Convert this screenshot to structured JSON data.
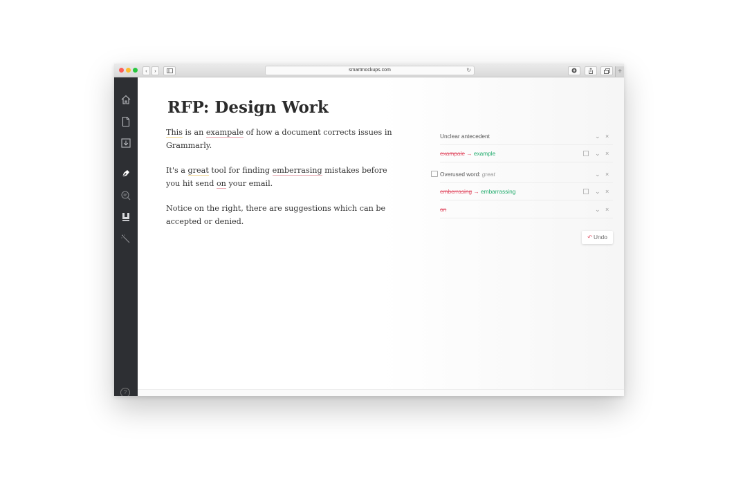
{
  "browser": {
    "url": "smartmockups.com",
    "nav_back": "‹",
    "nav_forward": "›",
    "reload": "↻"
  },
  "sidebar": {
    "icons": [
      "home-icon",
      "document-icon",
      "download-icon",
      "pen-icon",
      "search-icon",
      "book-icon",
      "wand-icon",
      "help-icon"
    ],
    "help": "?"
  },
  "document": {
    "title": "RFP: Design Work",
    "p1": {
      "a": "This",
      "b": " is an ",
      "c": "exampale",
      "d": " of how a document corrects issues in Grammarly."
    },
    "p2": {
      "a": "It's a ",
      "b": "great",
      "c": " tool for finding ",
      "d": "emberrasing",
      "e": " mistakes before you hit send ",
      "f": "on",
      "g": " your email."
    },
    "p3": "Notice on the right, there are suggestions which can be accepted or denied."
  },
  "suggestions": [
    {
      "label": "Unclear antecedent"
    },
    {
      "original": "exampale",
      "arrow": "→",
      "fix": "example"
    },
    {
      "label": "Overused word: ",
      "detail": "great"
    },
    {
      "original": "emberrasing",
      "arrow": "→",
      "fix": "embarrassing"
    },
    {
      "original": "on"
    }
  ],
  "controls": {
    "expand": "⌄",
    "dismiss": "×"
  },
  "undo": {
    "arrow": "↶",
    "label": "Undo"
  },
  "colors": {
    "error": "#e2566b",
    "fix": "#1eaa6a",
    "sidebar": "#2d2f33"
  }
}
